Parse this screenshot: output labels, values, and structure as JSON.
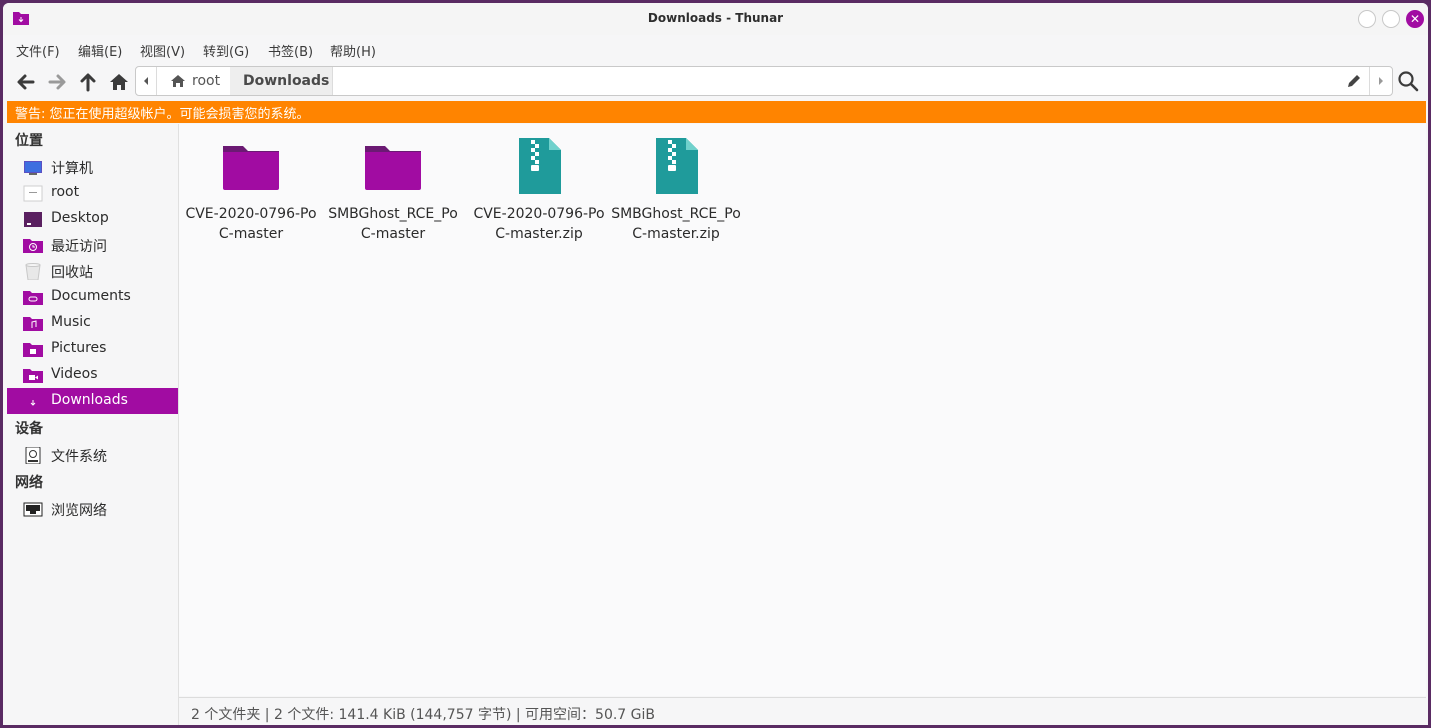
{
  "window": {
    "title": "Downloads - Thunar"
  },
  "menu": {
    "items": [
      "文件(F)",
      "编辑(E)",
      "视图(V)",
      "转到(G)",
      "书签(B)",
      "帮助(H)"
    ]
  },
  "pathbar": {
    "root_label": "root",
    "current_label": "Downloads"
  },
  "warning": {
    "text": "警告: 您正在使用超级帐户。可能会损害您的系统。"
  },
  "sidebar": {
    "places_title": "位置",
    "places": [
      {
        "label": "计算机",
        "icon": "computer-icon"
      },
      {
        "label": "root",
        "icon": "home-folder-icon"
      },
      {
        "label": "Desktop",
        "icon": "desktop-icon"
      },
      {
        "label": "最近访问",
        "icon": "recent-icon"
      },
      {
        "label": "回收站",
        "icon": "trash-icon"
      },
      {
        "label": "Documents",
        "icon": "documents-folder-icon"
      },
      {
        "label": "Music",
        "icon": "music-folder-icon"
      },
      {
        "label": "Pictures",
        "icon": "pictures-folder-icon"
      },
      {
        "label": "Videos",
        "icon": "videos-folder-icon"
      },
      {
        "label": "Downloads",
        "icon": "downloads-folder-icon",
        "active": true
      }
    ],
    "devices_title": "设备",
    "devices": [
      {
        "label": "文件系统",
        "icon": "drive-icon"
      }
    ],
    "network_title": "网络",
    "network": [
      {
        "label": "浏览网络",
        "icon": "network-icon"
      }
    ]
  },
  "files": [
    {
      "name": "CVE-2020-0796-PoC-master",
      "type": "folder"
    },
    {
      "name": "SMBGhost_RCE_PoC-master",
      "type": "folder"
    },
    {
      "name": "CVE-2020-0796-PoC-master.zip",
      "type": "zip"
    },
    {
      "name": "SMBGhost_RCE_PoC-master.zip",
      "type": "zip"
    }
  ],
  "status": {
    "text": "2 个文件夹 | 2 个文件: 141.4 KiB (144,757 字节) | 可用空间：50.7 GiB"
  },
  "colors": {
    "accent": "#a10ca2",
    "warning": "#ff8400",
    "zip": "#1f9b9b"
  }
}
